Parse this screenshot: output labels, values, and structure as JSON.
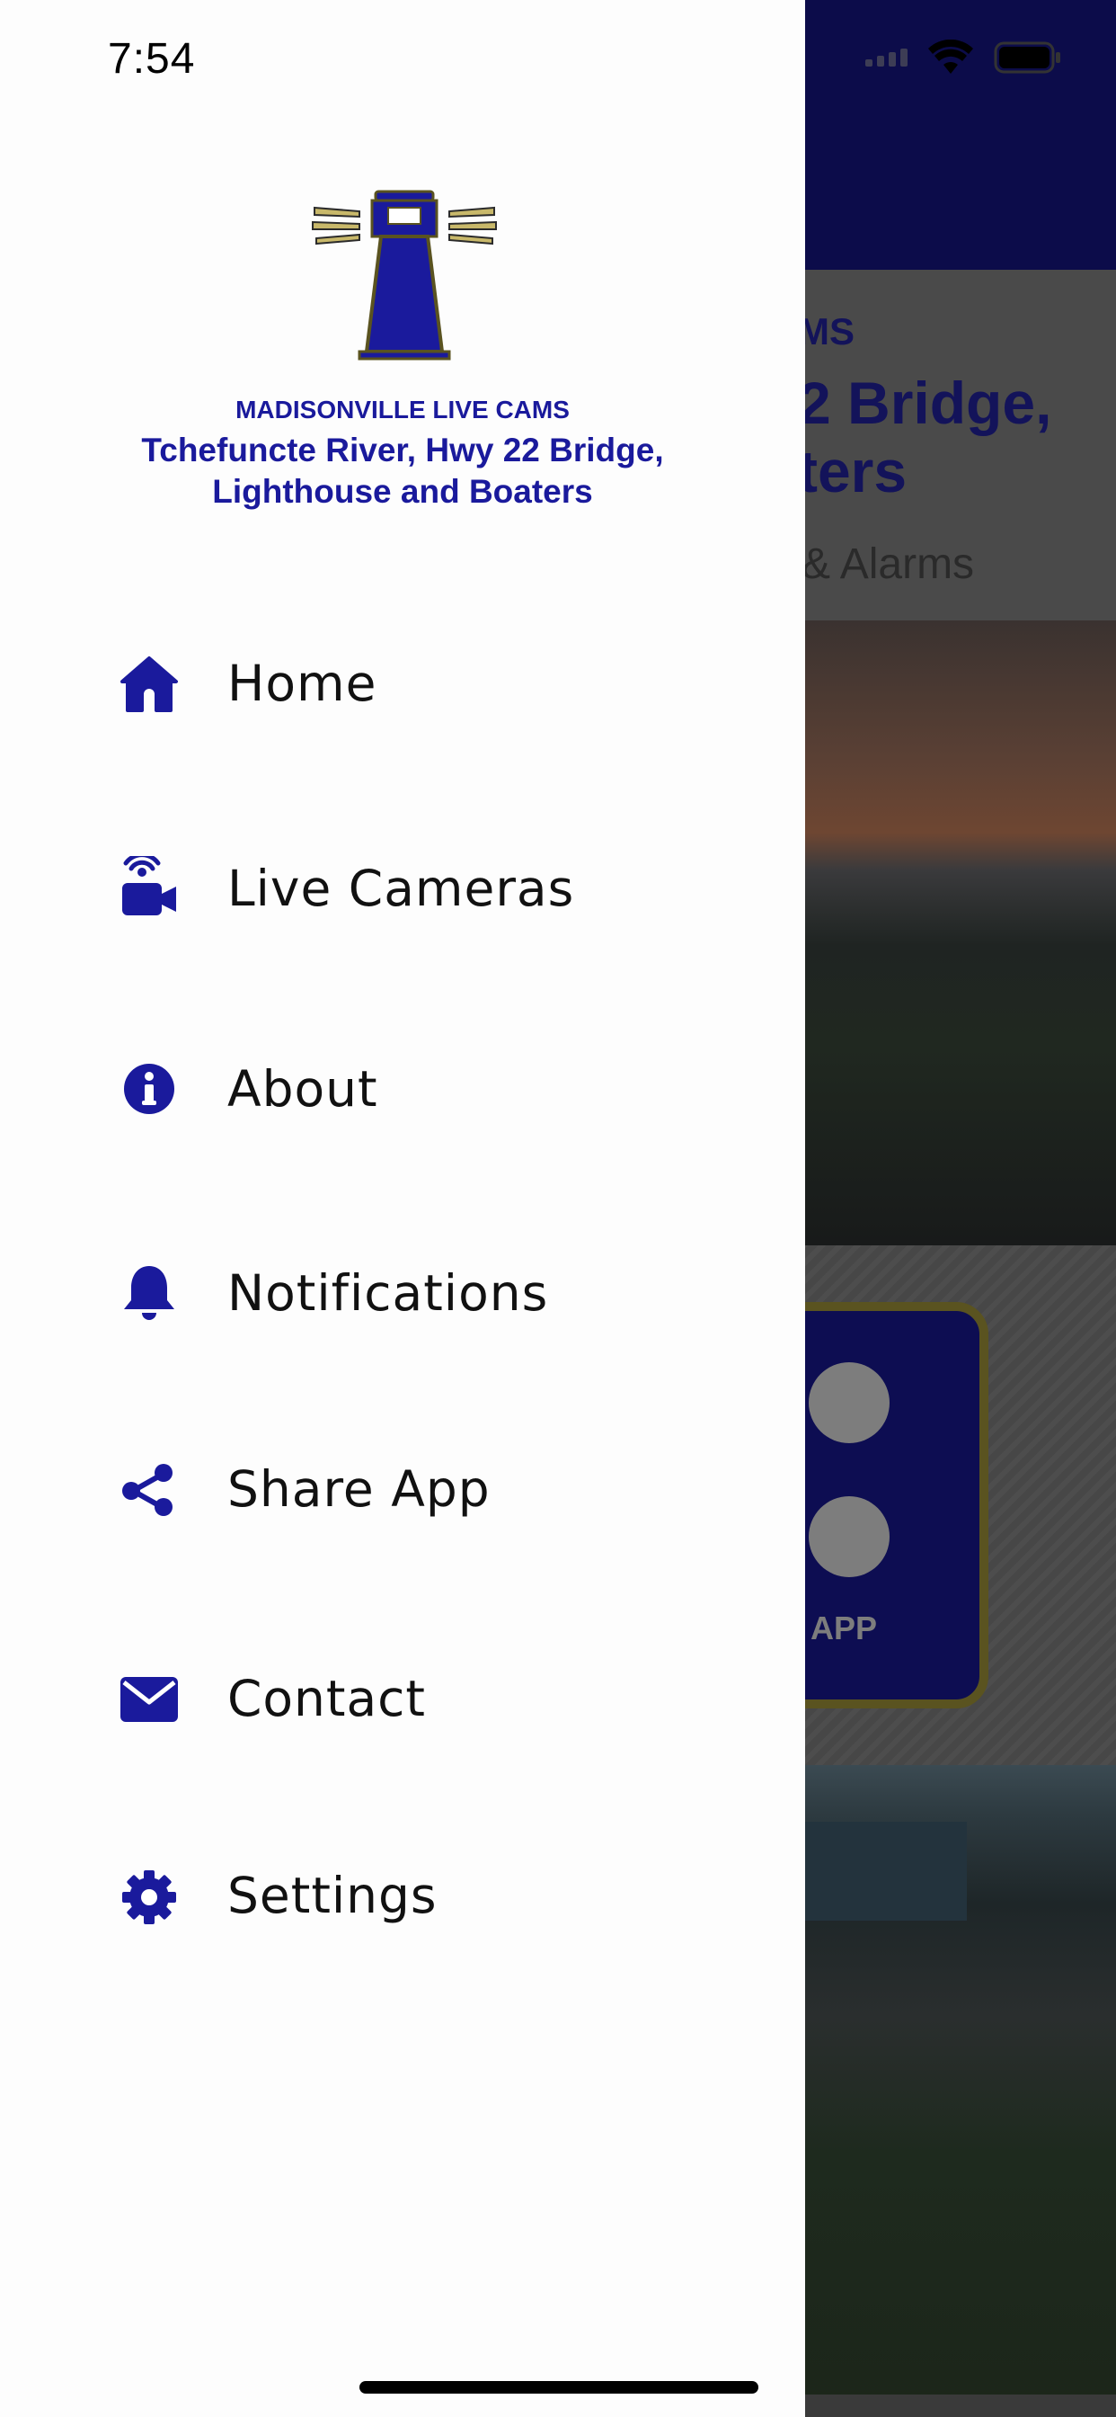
{
  "status_bar": {
    "time": "7:54"
  },
  "background_app": {
    "banner_line1": "MS",
    "banner_line2": "2 Bridge,",
    "banner_line3": "ters",
    "banner_line4": "& Alarms",
    "share_card_label": "APP"
  },
  "drawer": {
    "brand_small": "MADISONVILLE LIVE CAMS",
    "brand_title_line1": "Tchefuncte River, Hwy 22 Bridge,",
    "brand_title_line2": "Lighthouse and Boaters",
    "accent_color": "#1a1a9c",
    "menu": [
      {
        "label": "Home",
        "icon": "home-icon"
      },
      {
        "label": "Live Cameras",
        "icon": "camera-icon"
      },
      {
        "label": "About",
        "icon": "info-icon"
      },
      {
        "label": "Notifications",
        "icon": "bell-icon"
      },
      {
        "label": "Share App",
        "icon": "share-icon"
      },
      {
        "label": "Contact",
        "icon": "envelope-icon"
      },
      {
        "label": "Settings",
        "icon": "gear-icon"
      }
    ]
  }
}
